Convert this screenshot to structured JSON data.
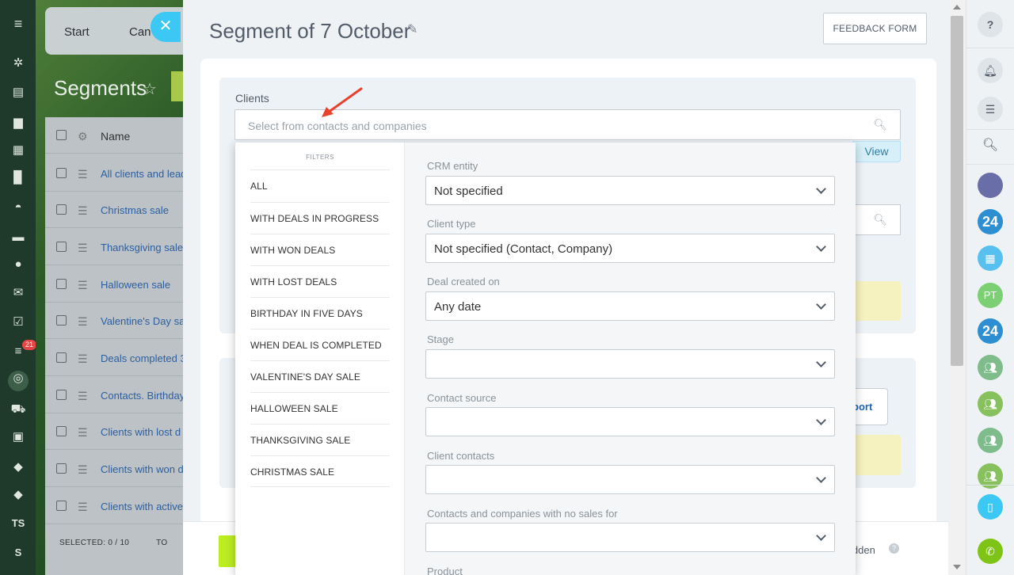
{
  "colors": {
    "accent_blue": "#3bc8f5",
    "green_button": "#bbed21",
    "link": "#2066b0",
    "arrow": "#e8422c"
  },
  "background_app": {
    "tabs": [
      "Start",
      "Can"
    ],
    "title": "Segments",
    "header_name": "Name",
    "rows": [
      "All clients and lead",
      "Christmas sale",
      "Thanksgiving sale",
      "Halloween sale",
      "Valentine's Day sa",
      "Deals completed 3",
      "Contacts. Birthday",
      "Clients with lost d",
      "Clients with won d",
      "Clients with active"
    ],
    "selected": "SELECTED: 0 / 10",
    "selected_tail": "TO"
  },
  "left_nav": {
    "badge": "21",
    "items": [
      "TS",
      "S"
    ]
  },
  "panel": {
    "title": "Segment of 7 October",
    "feedback": "FEEDBACK FORM",
    "clients_label": "Clients",
    "clients_placeholder": "Select from contacts and companies",
    "view": "View",
    "export_fragment": "port",
    "hidden_fragment": "idden"
  },
  "dropdown": {
    "filters_title": "FILTERS",
    "filters": [
      "ALL",
      "WITH DEALS IN PROGRESS",
      "WITH WON DEALS",
      "WITH LOST DEALS",
      "BIRTHDAY IN FIVE DAYS",
      "WHEN DEAL IS COMPLETED",
      "VALENTINE'S DAY SALE",
      "HALLOWEEN SALE",
      "THANKSGIVING SALE",
      "CHRISTMAS SALE"
    ],
    "fields": [
      {
        "label": "CRM entity",
        "value": "Not specified"
      },
      {
        "label": "Client type",
        "value": "Not specified (Contact, Company)"
      },
      {
        "label": "Deal created on",
        "value": "Any date"
      },
      {
        "label": "Stage",
        "value": ""
      },
      {
        "label": "Contact source",
        "value": ""
      },
      {
        "label": "Client contacts",
        "value": ""
      },
      {
        "label": "Contacts and companies with no sales for",
        "value": ""
      }
    ],
    "last_label": "Product"
  },
  "right_bar": {
    "b24_1": "24",
    "pt": "PT",
    "b24_2": "24"
  }
}
